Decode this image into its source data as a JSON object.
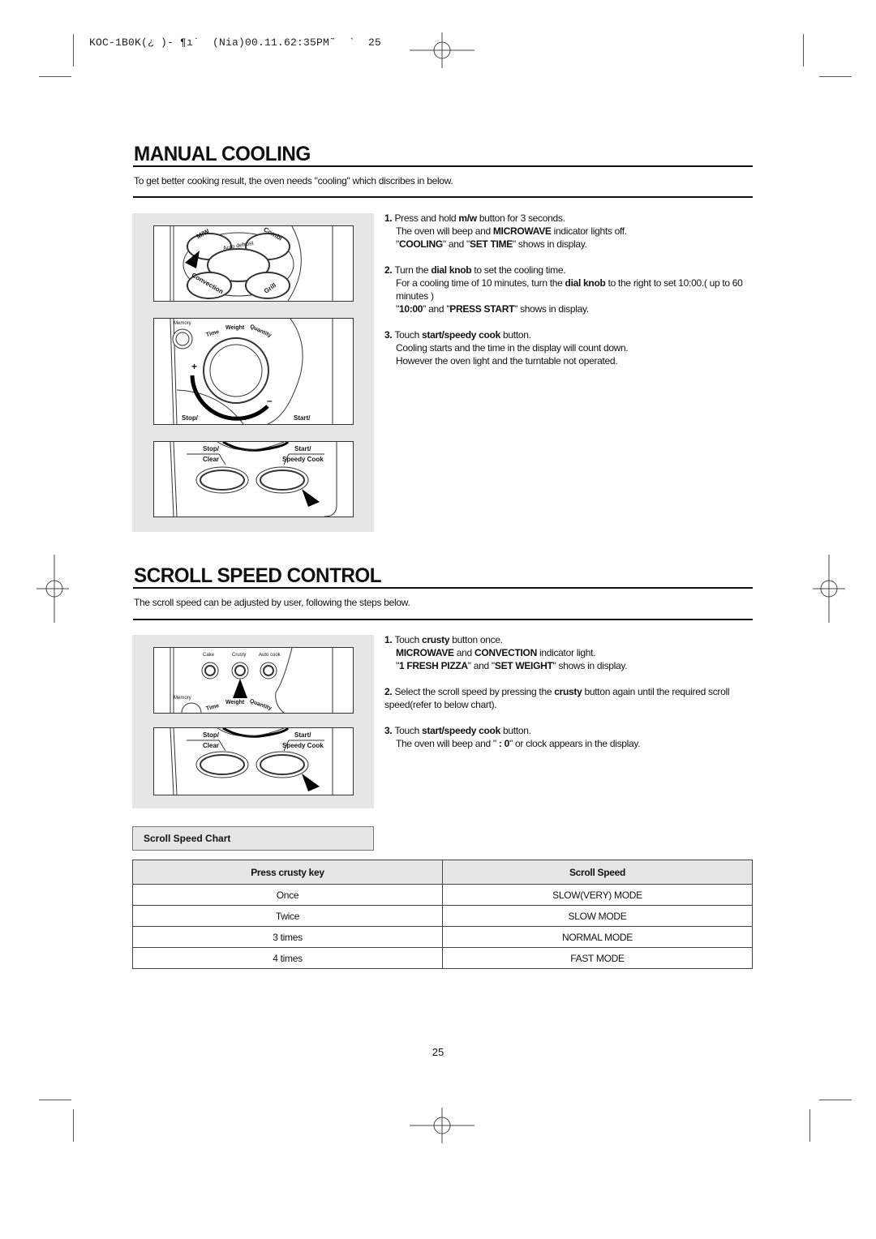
{
  "print_header": "KOC-1B0K(¿ )- ¶ı˙  (Nia)00.11.62:35PM˜  `  25",
  "manual_cooling": {
    "title": "MANUAL COOLING",
    "intro": "To get better cooking result, the oven needs \"cooling\" which discribes in below.",
    "figure": {
      "mode_buttons": [
        "M/W",
        "Combi",
        "Auto defrost",
        "Convection",
        "Grill"
      ],
      "memory_label": "Memory",
      "dial_labels": [
        "Time",
        "Weight",
        "Quantity"
      ],
      "dial_plus": "+",
      "dial_minus": "–",
      "stop_label": "Stop/",
      "start_label": "Start/",
      "stop_clear_top": "Stop/",
      "stop_clear_bottom": "Clear",
      "start_speedy_top": "Start/",
      "start_speedy_bottom": "Speedy Cook"
    },
    "steps": [
      {
        "num": "1.",
        "lines": [
          [
            {
              "t": "Press and hold "
            },
            {
              "b": "m/w"
            },
            {
              "t": " button for 3 seconds."
            }
          ],
          [
            {
              "t": "The oven will beep and "
            },
            {
              "b": "MICROWAVE"
            },
            {
              "t": " indicator lights off."
            }
          ],
          [
            {
              "t": "\""
            },
            {
              "b": "COOLING"
            },
            {
              "t": "\" and \""
            },
            {
              "b": "SET TIME"
            },
            {
              "t": "\" shows in display."
            }
          ]
        ]
      },
      {
        "num": "2.",
        "lines": [
          [
            {
              "t": "Turn the "
            },
            {
              "b": "dial knob"
            },
            {
              "t": " to set the cooling time."
            }
          ],
          [
            {
              "t": "For a cooling time of 10 minutes, turn the "
            },
            {
              "b": "dial knob"
            },
            {
              "t": " to the right to set 10:00.( up to 60 minutes )"
            }
          ],
          [
            {
              "t": "\""
            },
            {
              "b": "10:00"
            },
            {
              "t": "\" and \""
            },
            {
              "b": "PRESS START"
            },
            {
              "t": "\" shows in display."
            }
          ]
        ]
      },
      {
        "num": "3.",
        "lines": [
          [
            {
              "t": "Touch "
            },
            {
              "b": "start/speedy cook"
            },
            {
              "t": " button."
            }
          ],
          [
            {
              "t": "Cooling starts and the time in the display will count down."
            }
          ],
          [
            {
              "t": "However the oven light and the turntable not operated."
            }
          ]
        ]
      }
    ]
  },
  "scroll_speed": {
    "title": "SCROLL SPEED CONTROL",
    "intro": "The scroll speed can be adjusted by user, following the steps below.",
    "figure": {
      "top_buttons": [
        "Cake",
        "Crusty",
        "Auto cook"
      ],
      "memory_label": "Memory",
      "dial_labels": [
        "Time",
        "Weight",
        "Quantity"
      ],
      "stop_clear_top": "Stop/",
      "stop_clear_bottom": "Clear",
      "start_speedy_top": "Start/",
      "start_speedy_bottom": "Speedy Cook"
    },
    "steps": [
      {
        "num": "1.",
        "lines": [
          [
            {
              "t": "Touch "
            },
            {
              "b": "crusty"
            },
            {
              "t": " button once."
            }
          ],
          [
            {
              "b": "MICROWAVE"
            },
            {
              "t": " and "
            },
            {
              "b": "CONVECTION"
            },
            {
              "t": " indicator light."
            }
          ],
          [
            {
              "t": "\""
            },
            {
              "b": "1 FRESH PIZZA"
            },
            {
              "t": "\" and \""
            },
            {
              "b": "SET WEIGHT"
            },
            {
              "t": "\" shows in display."
            }
          ]
        ]
      },
      {
        "num": "2.",
        "lines": [
          [
            {
              "t": "Select the scroll speed by pressing the "
            },
            {
              "b": "crusty"
            },
            {
              "t": " button again until the required scroll speed(refer to below chart)."
            }
          ]
        ]
      },
      {
        "num": "3.",
        "lines": [
          [
            {
              "t": "Touch "
            },
            {
              "b": "start/speedy cook"
            },
            {
              "t": " button."
            }
          ],
          [
            {
              "t": "The oven will beep and \" "
            },
            {
              "b": ": 0"
            },
            {
              "t": "\" or clock appears in the display."
            }
          ]
        ]
      }
    ],
    "chart_label": "Scroll Speed Chart",
    "table": {
      "headers": [
        "Press crusty key",
        "Scroll Speed"
      ],
      "rows": [
        [
          "Once",
          "SLOW(VERY) MODE"
        ],
        [
          "Twice",
          "SLOW MODE"
        ],
        [
          "3 times",
          "NORMAL MODE"
        ],
        [
          "4 times",
          "FAST MODE"
        ]
      ]
    }
  },
  "page_number": "25"
}
